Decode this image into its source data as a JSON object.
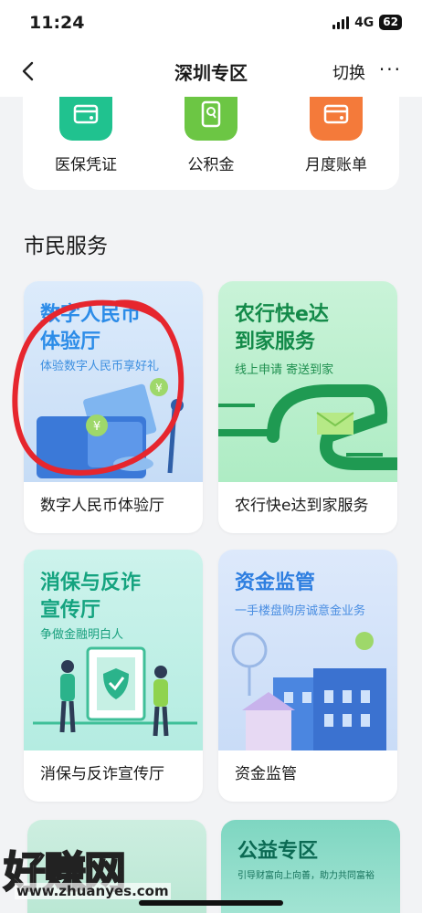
{
  "status": {
    "time": "11:24",
    "network": "4G",
    "battery": "62"
  },
  "nav": {
    "title": "深圳专区",
    "switch_label": "切换",
    "more": "···"
  },
  "shortcuts": [
    {
      "label": "医保凭证",
      "icon": "card-icon",
      "color": "#20c28f"
    },
    {
      "label": "公积金",
      "icon": "document-icon",
      "color": "#6cc644"
    },
    {
      "label": "月度账单",
      "icon": "bill-icon",
      "color": "#f47a3a"
    }
  ],
  "section": {
    "title": "市民服务"
  },
  "cards": [
    {
      "title_line1": "数字人民币",
      "title_line2": "体验厅",
      "subtitle": "体验数字人民币享好礼",
      "label": "数字人民币体验厅"
    },
    {
      "title_line1": "农行快e达",
      "title_line2": "到家服务",
      "subtitle": "线上申请 寄送到家",
      "label": "农行快e达到家服务"
    },
    {
      "title_line1": "消保与反诈",
      "title_line2": "宣传厅",
      "subtitle": "争做金融明白人",
      "label": "消保与反诈宣传厅"
    },
    {
      "title_line1": "资金监管",
      "title_line2": "",
      "subtitle": "一手楼盘购房诚意金业务",
      "label": "资金监管"
    },
    {
      "title_line1": "",
      "title_line2": "",
      "subtitle": "",
      "label": ""
    },
    {
      "title_line1": "公益专区",
      "title_line2": "",
      "subtitle": "引导财富向上向善，助力共同富裕",
      "label": ""
    }
  ],
  "watermark": {
    "text": "好赚网",
    "url": "www.zhuanyes.com"
  }
}
